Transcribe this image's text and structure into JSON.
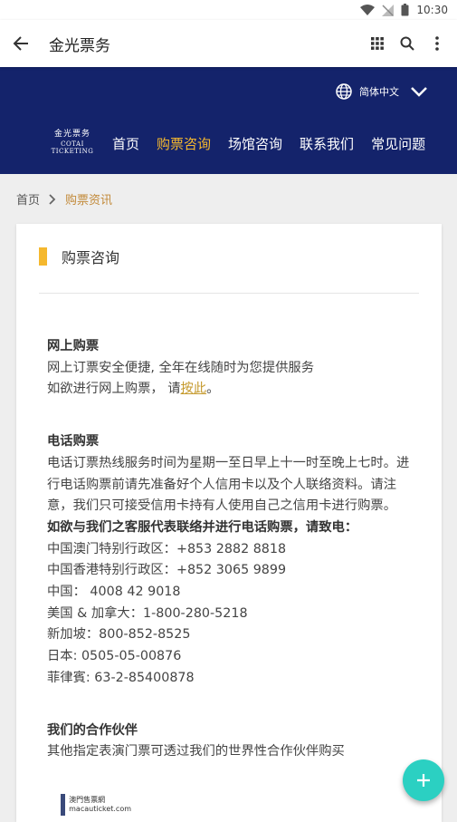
{
  "status_bar": {
    "time": "10:30"
  },
  "app_bar": {
    "title": "金光票务"
  },
  "site_header": {
    "language": "简体中文",
    "logo_line1": "金光票务",
    "logo_line2": "COTAI TICKETING",
    "nav": [
      "首页",
      "购票咨询",
      "场馆咨询",
      "联系我们",
      "常见问题"
    ]
  },
  "breadcrumb": {
    "home": "首页",
    "current": "购票资讯"
  },
  "card": {
    "title": "购票咨询",
    "online_heading": "网上购票",
    "online_line1": "网上订票安全便捷, 全年在线随时为您提供服务",
    "online_line2_prefix": "如欲进行网上购票， 请",
    "online_link": "按此",
    "online_line2_suffix": "。",
    "phone_heading": "电话购票",
    "phone_desc": "电话订票热线服务时间为星期一至日早上十一时至晚上七时。进行电话购票前请先准备好个人信用卡以及个人联络资料。请注意，我们只可接受信用卡持有人使用自己之信用卡进行购票。",
    "phone_contact_heading": "如欲与我们之客服代表联络并进行电话购票，请致电：",
    "phone_lines": [
      "中国澳门特别行政区：+853 2882 8818",
      "中国香港特别行政区：+852 3065 9899",
      "中国：  4008 42 9018",
      "美国 & 加拿大：1-800-280-5218",
      "新加坡：800-852-8525",
      "日本: 0505-05-00876",
      "菲律賓: 63-2-85400878"
    ],
    "partner_heading": "我们的合作伙伴",
    "partner_desc": "其他指定表演门票可透过我们的世界性合作伙伴购买",
    "partner_logo_line1": "澳門售票網",
    "partner_logo_line2": "macauticket.com"
  },
  "icons": {
    "back": "arrow-left-icon",
    "grid": "grid-icon",
    "search": "search-icon",
    "more": "more-vert-icon",
    "globe": "globe-icon",
    "dropdown": "chevron-down-icon",
    "fab": "plus-icon"
  },
  "colors": {
    "header_bg": "#14236b",
    "accent": "#f5b82e",
    "fab": "#2bd0c2"
  }
}
